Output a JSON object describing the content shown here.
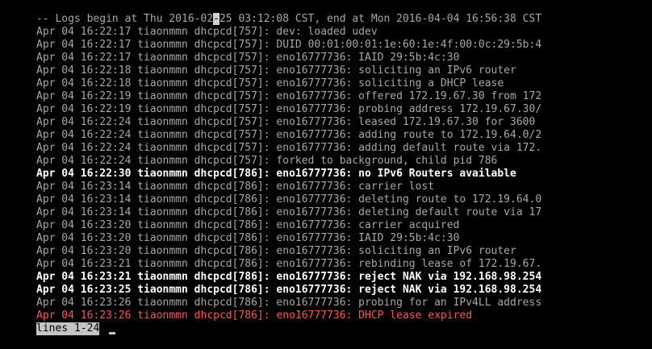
{
  "terminal": {
    "header": {
      "before_cursor": "-- Logs begin at Thu 2016-02",
      "cursor_char": "-",
      "after_cursor": "25 03:12:08 CST, end at Mon 2016-04-04 16:56:38 CST"
    },
    "lines": [
      {
        "prefix": "Apr 04 16:22:17 tiaonmmn dhcpcd[757]:",
        "message": "dev: loaded udev",
        "style": "normal"
      },
      {
        "prefix": "Apr 04 16:22:17 tiaonmmn dhcpcd[757]:",
        "message": "DUID 00:01:00:01:1e:60:1e:4f:00:0c:29:5b:4",
        "style": "normal"
      },
      {
        "prefix": "Apr 04 16:22:17 tiaonmmn dhcpcd[757]:",
        "message": "eno16777736: IAID 29:5b:4c:30",
        "style": "normal"
      },
      {
        "prefix": "Apr 04 16:22:18 tiaonmmn dhcpcd[757]:",
        "message": "eno16777736: soliciting an IPv6 router",
        "style": "normal"
      },
      {
        "prefix": "Apr 04 16:22:18 tiaonmmn dhcpcd[757]:",
        "message": "eno16777736: soliciting a DHCP lease",
        "style": "normal"
      },
      {
        "prefix": "Apr 04 16:22:19 tiaonmmn dhcpcd[757]:",
        "message": "eno16777736: offered 172.19.67.30 from 172",
        "style": "normal"
      },
      {
        "prefix": "Apr 04 16:22:19 tiaonmmn dhcpcd[757]:",
        "message": "eno16777736: probing address 172.19.67.30/",
        "style": "normal"
      },
      {
        "prefix": "Apr 04 16:22:24 tiaonmmn dhcpcd[757]:",
        "message": "eno16777736: leased 172.19.67.30 for 3600",
        "style": "normal"
      },
      {
        "prefix": "Apr 04 16:22:24 tiaonmmn dhcpcd[757]:",
        "message": "eno16777736: adding route to 172.19.64.0/2",
        "style": "normal"
      },
      {
        "prefix": "Apr 04 16:22:24 tiaonmmn dhcpcd[757]:",
        "message": "eno16777736: adding default route via 172.",
        "style": "normal"
      },
      {
        "prefix": "Apr 04 16:22:24 tiaonmmn dhcpcd[757]:",
        "message": "forked to background, child pid 786",
        "style": "normal"
      },
      {
        "prefix": "Apr 04 16:22:30 tiaonmmn dhcpcd[786]:",
        "message": "eno16777736: no IPv6 Routers available",
        "style": "highlight"
      },
      {
        "prefix": "Apr 04 16:23:14 tiaonmmn dhcpcd[786]:",
        "message": "eno16777736: carrier lost",
        "style": "normal"
      },
      {
        "prefix": "Apr 04 16:23:14 tiaonmmn dhcpcd[786]:",
        "message": "eno16777736: deleting route to 172.19.64.0",
        "style": "normal"
      },
      {
        "prefix": "Apr 04 16:23:14 tiaonmmn dhcpcd[786]:",
        "message": "eno16777736: deleting default route via 17",
        "style": "normal"
      },
      {
        "prefix": "Apr 04 16:23:20 tiaonmmn dhcpcd[786]:",
        "message": "eno16777736: carrier acquired",
        "style": "normal"
      },
      {
        "prefix": "Apr 04 16:23:20 tiaonmmn dhcpcd[786]:",
        "message": "eno16777736: IAID 29:5b:4c:30",
        "style": "normal"
      },
      {
        "prefix": "Apr 04 16:23:20 tiaonmmn dhcpcd[786]:",
        "message": "eno16777736: soliciting an IPv6 router",
        "style": "normal"
      },
      {
        "prefix": "Apr 04 16:23:21 tiaonmmn dhcpcd[786]:",
        "message": "eno16777736: rebinding lease of 172.19.67.",
        "style": "normal"
      },
      {
        "prefix": "Apr 04 16:23:21 tiaonmmn dhcpcd[786]:",
        "message": "eno16777736: reject NAK via 192.168.98.254",
        "style": "highlight"
      },
      {
        "prefix": "Apr 04 16:23:25 tiaonmmn dhcpcd[786]:",
        "message": "eno16777736: reject NAK via 192.168.98.254",
        "style": "highlight"
      },
      {
        "prefix": "Apr 04 16:23:26 tiaonmmn dhcpcd[786]:",
        "message": "eno16777736: probing for an IPv4LL address",
        "style": "normal"
      },
      {
        "prefix": "Apr 04 16:23:26 tiaonmmn dhcpcd[786]:",
        "message": "eno16777736: DHCP lease expired",
        "style": "error"
      }
    ],
    "status_bar": "lines 1-24"
  },
  "colors": {
    "background": "#000000",
    "normal_text": "#a8a8a8",
    "highlight_text": "#ffffff",
    "error_text": "#ff5555",
    "status_bg": "#c4c4c4"
  }
}
